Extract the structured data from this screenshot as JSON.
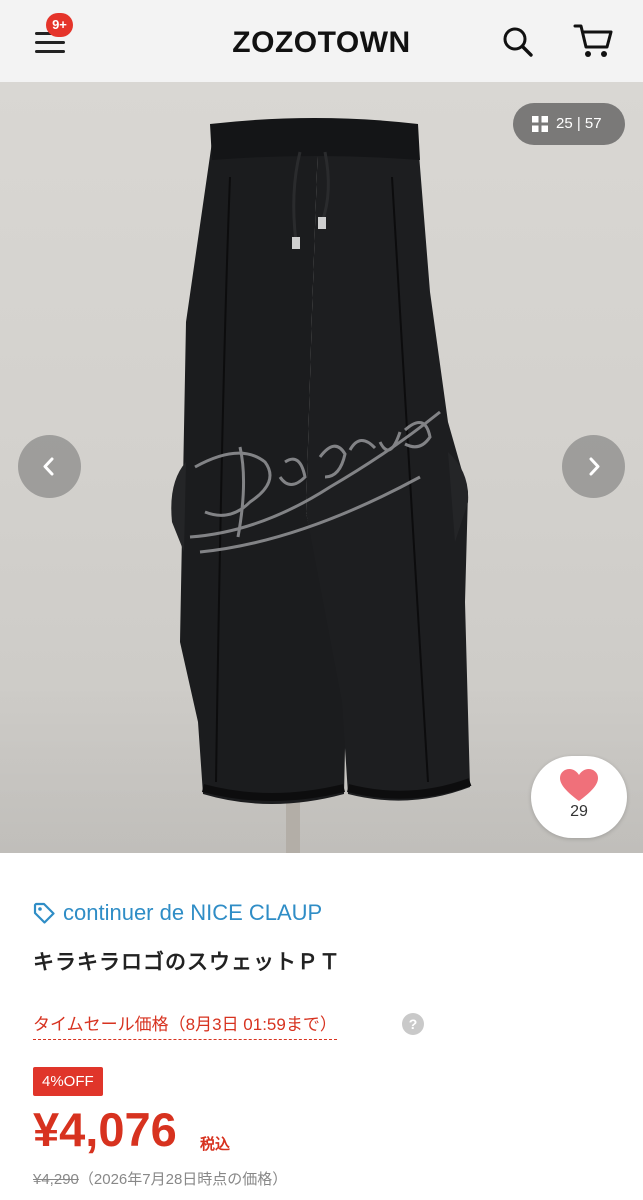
{
  "header": {
    "badge": "9+",
    "logo": "ZOZOTOWN",
    "icons": {
      "menu": "hamburger-menu-icon",
      "search": "search-icon",
      "cart": "cart-icon"
    }
  },
  "gallery": {
    "counter": "25 | 57",
    "current_index": 25,
    "total": 57,
    "favorite_count": "29",
    "icons": {
      "grid": "grid-icon",
      "prev": "chevron-left-icon",
      "next": "chevron-right-icon",
      "heart": "heart-icon"
    }
  },
  "product": {
    "brand": "continuer de NICE CLAUP",
    "name": "キラキラロゴのスウェットＰＴ",
    "sale_label": "タイムセール価格（8月3日 01:59まで）",
    "help": "?",
    "discount_badge": "4%OFF",
    "price": "¥4,076",
    "tax_label": "税込",
    "original_price": "¥4,290",
    "original_price_note": "（2026年7月28日時点の価格）"
  },
  "colors": {
    "accent_red": "#d7321f",
    "brand_blue": "#2f8dc6",
    "heart_pink": "#f0707a",
    "header_bg": "#f3f3f3"
  }
}
